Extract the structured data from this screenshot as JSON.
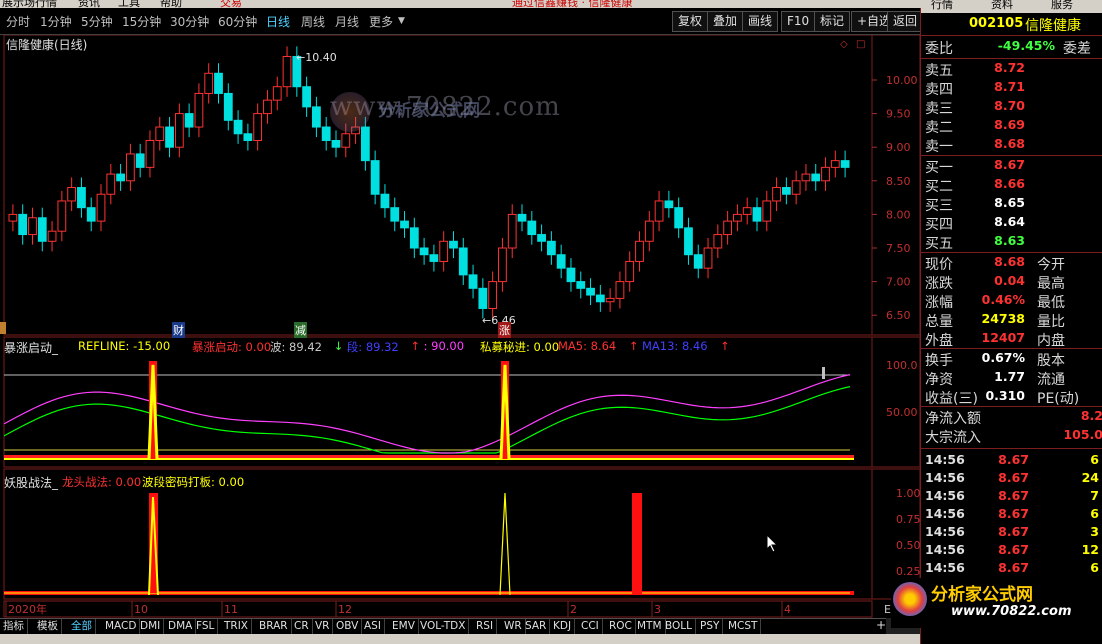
{
  "menubar": {
    "items": [
      "展示场行情",
      "资讯",
      "工具",
      "帮助",
      "交易",
      "通过信鑫赚钱 · 信隆健康"
    ]
  },
  "toolbar": {
    "periods": [
      "分时",
      "1分钟",
      "5分钟",
      "15分钟",
      "30分钟",
      "60分钟",
      "日线",
      "周线",
      "月线",
      "更多"
    ],
    "active_period": "日线",
    "buttons": [
      "复权",
      "叠加",
      "画线",
      "F10",
      "标记",
      "+自选",
      "返回"
    ]
  },
  "chart": {
    "title": "信隆健康(日线)",
    "high_label": "10.40",
    "low_label": "6.46",
    "watermark": "www.70822.com",
    "watermark_logo": "分析家公式网",
    "markers": [
      {
        "text": "财"
      },
      {
        "text": "减"
      },
      {
        "text": "涨"
      }
    ],
    "price_ticks": [
      "10.00",
      "9.50",
      "9.00",
      "8.50",
      "8.00",
      "7.50",
      "7.00",
      "6.50"
    ],
    "colors": {
      "up": "#ff3232",
      "down": "#00e0e0",
      "ma_green": "#00ff00",
      "ma_magenta": "#ff40ff",
      "yellow": "#ffff00",
      "red": "#ff0000"
    }
  },
  "indicator1": {
    "name": "暴涨启动_",
    "items": [
      {
        "text": "REFLINE: -15.00",
        "color": "#ffff00"
      },
      {
        "text": "暴涨启动: 0.00",
        "color": "#ff3030"
      },
      {
        "text": "波: 89.42",
        "color": "#c8c8c8"
      },
      {
        "text": "↓",
        "color": "#40ff40"
      },
      {
        "text": "段: 89.32",
        "color": "#4040ff"
      },
      {
        "text": "↑",
        "color": "#ff3030"
      },
      {
        "text": ": 90.00",
        "color": "#ff40ff"
      },
      {
        "text": "私募秘进: 0.00",
        "color": "#ffff00"
      },
      {
        "text": "MA5: 8.64",
        "color": "#ff3030"
      },
      {
        "text": "↑",
        "color": "#ff3030"
      },
      {
        "text": "MA13: 8.46",
        "color": "#4040ff"
      },
      {
        "text": "↑",
        "color": "#ff3030"
      }
    ],
    "ticks": [
      "100.0",
      "50.00"
    ]
  },
  "indicator2": {
    "name": "妖股战法_",
    "items": [
      {
        "text": "龙头战法: 0.00",
        "color": "#ff3030"
      },
      {
        "text": "波段密码打板: 0.00",
        "color": "#ffff00"
      }
    ],
    "ticks": [
      "1.00",
      "0.75",
      "0.50",
      "0.25"
    ]
  },
  "time_axis": [
    "2020年",
    "10",
    "11",
    "12",
    "2",
    "3",
    "4"
  ],
  "time_axis_end": "E",
  "tabs": [
    "指标",
    "模板",
    "全部",
    "MACD",
    "DMI",
    "DMA",
    "FSL",
    "TRIX",
    "BRAR",
    "CR",
    "VR",
    "OBV",
    "ASI",
    "EMV",
    "VOL-TDX",
    "RSI",
    "WR",
    "SAR",
    "KDJ",
    "CCI",
    "ROC",
    "MTM",
    "BOLL",
    "PSY",
    "MCST"
  ],
  "active_tab": "全部",
  "tab_plus": "+",
  "right_panel": {
    "top_tabs": [
      "行情",
      "资料",
      "服务"
    ],
    "code": "002105",
    "name": "信隆健康",
    "weibi": {
      "label": "委比",
      "value": "-49.45%",
      "right": "委差"
    },
    "asks": [
      {
        "label": "卖五",
        "price": "8.72"
      },
      {
        "label": "卖四",
        "price": "8.71"
      },
      {
        "label": "卖三",
        "price": "8.70"
      },
      {
        "label": "卖二",
        "price": "8.69"
      },
      {
        "label": "卖一",
        "price": "8.68"
      }
    ],
    "bids": [
      {
        "label": "买一",
        "price": "8.67",
        "color": "#ff3232"
      },
      {
        "label": "买二",
        "price": "8.66",
        "color": "#ff3232"
      },
      {
        "label": "买三",
        "price": "8.65",
        "color": "#ffffff"
      },
      {
        "label": "买四",
        "price": "8.64",
        "color": "#ffffff"
      },
      {
        "label": "买五",
        "price": "8.63",
        "color": "#40ff40"
      }
    ],
    "stats": [
      {
        "label": "现价",
        "value": "8.68",
        "color": "#ff3232",
        "right": "今开"
      },
      {
        "label": "涨跌",
        "value": "0.04",
        "color": "#ff3232",
        "right": "最高"
      },
      {
        "label": "涨幅",
        "value": "0.46%",
        "color": "#ff3232",
        "right": "最低"
      },
      {
        "label": "总量",
        "value": "24738",
        "color": "#ffff00",
        "right": "量比"
      },
      {
        "label": "外盘",
        "value": "12407",
        "color": "#ff3232",
        "right": "内盘"
      }
    ],
    "stats2": [
      {
        "label": "换手",
        "value": "0.67%",
        "color": "#ffffff",
        "right": "股本"
      },
      {
        "label": "净资",
        "value": "1.77",
        "color": "#ffffff",
        "right": "流通"
      },
      {
        "label": "收益(三)",
        "value": "0.310",
        "color": "#ffffff",
        "right": "PE(动)"
      }
    ],
    "flows": [
      {
        "label": "净流入额",
        "value": "8.2"
      },
      {
        "label": "大宗流入",
        "value": "105.0"
      }
    ],
    "ticks": [
      {
        "time": "14:56",
        "price": "8.67",
        "vol": "6"
      },
      {
        "time": "14:56",
        "price": "8.67",
        "vol": "24"
      },
      {
        "time": "14:56",
        "price": "8.67",
        "vol": "7"
      },
      {
        "time": "14:56",
        "price": "8.67",
        "vol": "6"
      },
      {
        "time": "14:56",
        "price": "8.67",
        "vol": "3"
      },
      {
        "time": "14:56",
        "price": "8.67",
        "vol": "12"
      },
      {
        "time": "14:56",
        "price": "8.67",
        "vol": "6"
      }
    ],
    "logo_text": "分析家公式网",
    "logo_url": "www.70822.com"
  }
}
